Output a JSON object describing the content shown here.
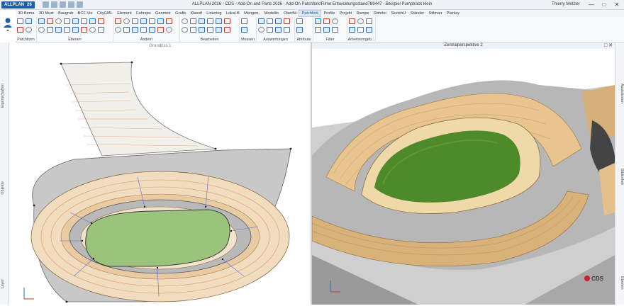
{
  "titlebar": {
    "app_name": "ALLPLAN",
    "app_version": "26",
    "title": "ALLPLAN 2026 - CDS - Add-On and Parts 2026 - Add-On Patchfork/Filme Entwicklungsstand789447 - Beispiel Pumptrack klein",
    "user": "Thierry Metzler"
  },
  "tabs": [
    "3D Bema",
    "3D Must",
    "Baugrub",
    "BCF-Vie",
    "CityGML",
    "Element",
    "Fahrspu",
    "Geometr",
    "Grafik",
    "Klassif",
    "Liniering",
    "Lokal-B",
    "Mengen-",
    "Modellin",
    "Oberflä",
    "Patchfork",
    "Profile",
    "Projekt",
    "Rampe",
    "Rohrlei",
    "SketchU",
    "Ständer",
    "Stilman",
    "Planlay"
  ],
  "active_tab": "Patchfork",
  "ribbon_groups": [
    {
      "label": "Patchform"
    },
    {
      "label": "Ebenen"
    },
    {
      "label": "Ändern"
    },
    {
      "label": "Bearbeiten"
    },
    {
      "label": "Messen"
    },
    {
      "label": "Auswertungen"
    },
    {
      "label": "Attribute"
    },
    {
      "label": "Filter"
    },
    {
      "label": "Arbeitsumgeb..."
    }
  ],
  "left_panel_labels": [
    "Eigenschaften",
    "Objekte",
    "Layer"
  ],
  "right_panel_labels": [
    "Assistenten",
    "Bibliothek",
    "Ebenen"
  ],
  "viewports": {
    "left_title": "Grundriss 1",
    "right_title": "Zentralperspektive 2"
  },
  "logo_text": "CDS",
  "colors": {
    "accent": "#1f5fa8",
    "grass": "#4e8a2a",
    "concrete": "#bcbcbc",
    "wood": "#e6c592"
  }
}
